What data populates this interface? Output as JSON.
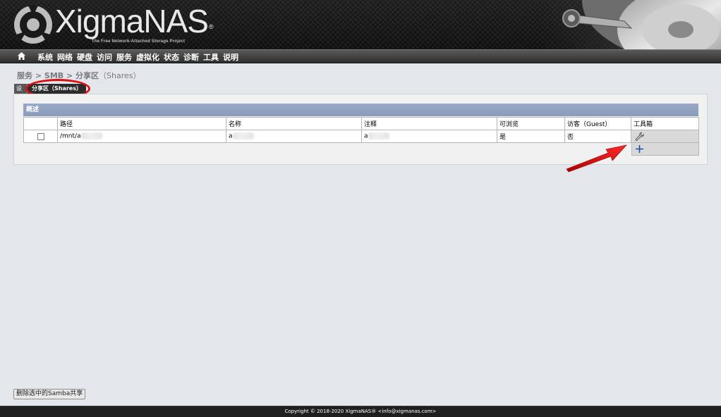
{
  "header": {
    "logo_text": "XigmaNAS",
    "logo_reg": "®",
    "tagline": "The Free Network-Attached Storage Project"
  },
  "nav": {
    "home_icon": "home-icon",
    "items": [
      "系统",
      "网络",
      "硬盘",
      "访问",
      "服务",
      "虚拟化",
      "状态",
      "诊断",
      "工具",
      "说明"
    ]
  },
  "breadcrumb": {
    "part1": "服务",
    "sep1": " > ",
    "part2": "SMB",
    "sep2": " > ",
    "part3": "分享区",
    "part3_en": "（Shares）"
  },
  "tabs": [
    {
      "label": "设置",
      "active": false
    },
    {
      "label": "分享区（Shares）",
      "active": true
    }
  ],
  "section": {
    "title": "概述"
  },
  "table": {
    "headers": [
      "",
      "路径",
      "名称",
      "注释",
      "可浏览",
      "访客（Guest）",
      "工具箱"
    ],
    "rows": [
      {
        "path": "/mnt/a",
        "name": "a",
        "comment": "a",
        "browseable": "是",
        "guest": "否",
        "edit_icon": "wrench-icon"
      }
    ],
    "add_icon": "plus-icon"
  },
  "buttons": {
    "delete_selected": "删除选中的Samba共享"
  },
  "footer": {
    "text": "Copyright © 2018-2020 XigmaNAS® <info@xigmanas.com>"
  },
  "colors": {
    "section_header": "#8a9cbb",
    "annotation": "#d81010",
    "nav_bg": "#3a3a3a"
  }
}
